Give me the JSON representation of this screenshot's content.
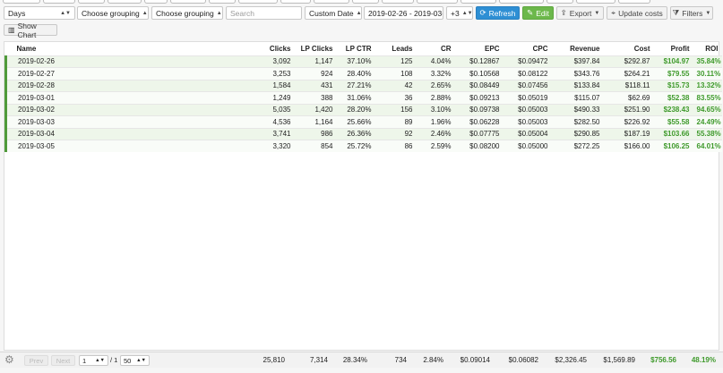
{
  "toolbar": {
    "days": "Days",
    "grouping1": "Choose grouping",
    "grouping2": "Choose grouping",
    "search_placeholder": "Search",
    "date_preset": "Custom Date",
    "date_range": "2019-02-26 - 2019-03-05",
    "timezone": "+3",
    "refresh": "Refresh",
    "edit": "Edit",
    "export": "Export",
    "update_costs": "Update costs",
    "filters": "Filters"
  },
  "show_chart": "Show Chart",
  "columns": [
    "Name",
    "Clicks",
    "LP Clicks",
    "LP CTR",
    "Leads",
    "CR",
    "EPC",
    "CPC",
    "Revenue",
    "Cost",
    "Profit",
    "ROI"
  ],
  "rows": [
    [
      "2019-02-26",
      "3,092",
      "1,147",
      "37.10%",
      "125",
      "4.04%",
      "$0.12867",
      "$0.09472",
      "$397.84",
      "$292.87",
      "$104.97",
      "35.84%"
    ],
    [
      "2019-02-27",
      "3,253",
      "924",
      "28.40%",
      "108",
      "3.32%",
      "$0.10568",
      "$0.08122",
      "$343.76",
      "$264.21",
      "$79.55",
      "30.11%"
    ],
    [
      "2019-02-28",
      "1,584",
      "431",
      "27.21%",
      "42",
      "2.65%",
      "$0.08449",
      "$0.07456",
      "$133.84",
      "$118.11",
      "$15.73",
      "13.32%"
    ],
    [
      "2019-03-01",
      "1,249",
      "388",
      "31.06%",
      "36",
      "2.88%",
      "$0.09213",
      "$0.05019",
      "$115.07",
      "$62.69",
      "$52.38",
      "83.55%"
    ],
    [
      "2019-03-02",
      "5,035",
      "1,420",
      "28.20%",
      "156",
      "3.10%",
      "$0.09738",
      "$0.05003",
      "$490.33",
      "$251.90",
      "$238.43",
      "94.65%"
    ],
    [
      "2019-03-03",
      "4,536",
      "1,164",
      "25.66%",
      "89",
      "1.96%",
      "$0.06228",
      "$0.05003",
      "$282.50",
      "$226.92",
      "$55.58",
      "24.49%"
    ],
    [
      "2019-03-04",
      "3,741",
      "986",
      "26.36%",
      "92",
      "2.46%",
      "$0.07775",
      "$0.05004",
      "$290.85",
      "$187.19",
      "$103.66",
      "55.38%"
    ],
    [
      "2019-03-05",
      "3,320",
      "854",
      "25.72%",
      "86",
      "2.59%",
      "$0.08200",
      "$0.05000",
      "$272.25",
      "$166.00",
      "$106.25",
      "64.01%"
    ]
  ],
  "footer": {
    "prev": "Prev",
    "next": "Next",
    "page": "1",
    "of": "/ 1",
    "page_size": "50",
    "totals": [
      "25,810",
      "7,314",
      "28.34%",
      "734",
      "2.84%",
      "$0.09014",
      "$0.06082",
      "$2,326.45",
      "$1,569.89",
      "$756.56",
      "48.19%"
    ]
  },
  "colors": {
    "accent_green": "#3f9a2c",
    "refresh_blue": "#2e8fd4",
    "edit_green": "#6cb84b"
  }
}
